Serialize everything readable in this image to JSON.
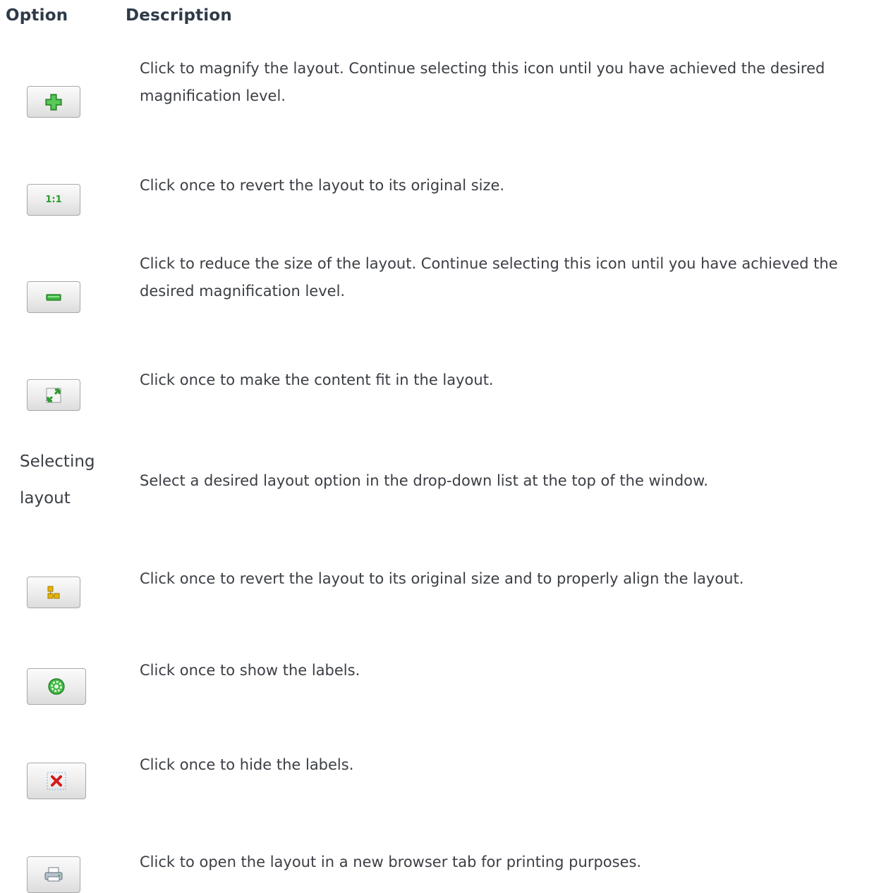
{
  "header": {
    "option": "Option",
    "description": "Description"
  },
  "rows": [
    {
      "icon": "zoom-in-icon",
      "description": "Click to magnify the layout. Continue selecting this icon until you have achieved the desired magnification level."
    },
    {
      "icon": "actual-size-icon",
      "icon_text": "1:1",
      "description": "Click once to revert the layout to its original size."
    },
    {
      "icon": "zoom-out-icon",
      "description": "Click to reduce the size of the layout. Continue selecting this icon until you have achieved the desired magnification level."
    },
    {
      "icon": "fit-content-icon",
      "description": "Click once to make the content fit in the layout."
    },
    {
      "option_text": "Selecting layout",
      "description": "Select a desired layout option in the drop-down list at the top of the window."
    },
    {
      "icon": "align-layout-icon",
      "description": "Click once to revert the layout to its original size and to properly align the layout."
    },
    {
      "icon": "show-labels-icon",
      "description": "Click once to show the labels."
    },
    {
      "icon": "hide-labels-icon",
      "description": "Click once to hide the labels."
    },
    {
      "icon": "print-icon",
      "description": "Click to open the layout in a new browser tab for printing purposes."
    }
  ]
}
